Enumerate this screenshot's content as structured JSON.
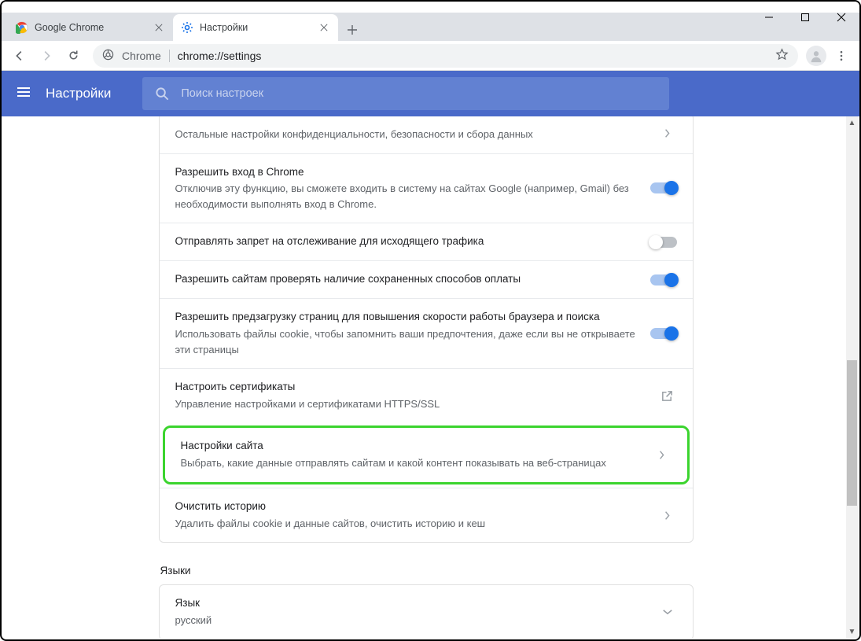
{
  "window": {
    "tabs": [
      {
        "title": "Google Chrome"
      },
      {
        "title": "Настройки"
      }
    ]
  },
  "omnibox": {
    "chrome_label": "Chrome",
    "url": "chrome://settings"
  },
  "header": {
    "title": "Настройки",
    "search_placeholder": "Поиск настроек"
  },
  "rows": {
    "sync": {
      "sub": "Остальные настройки конфиденциальности, безопасности и сбора данных"
    },
    "signin": {
      "title": "Разрешить вход в Chrome",
      "sub": "Отключив эту функцию, вы сможете входить в систему на сайтах Google (например, Gmail) без необходимости выполнять вход в Chrome."
    },
    "dnt": {
      "title": "Отправлять запрет на отслеживание для исходящего трафика"
    },
    "payment": {
      "title": "Разрешить сайтам проверять наличие сохраненных способов оплаты"
    },
    "preload": {
      "title": "Разрешить предзагрузку страниц для повышения скорости работы браузера и поиска",
      "sub": "Использовать файлы cookie, чтобы запомнить ваши предпочтения, даже если вы не открываете эти страницы"
    },
    "certs": {
      "title": "Настроить сертификаты",
      "sub": "Управление настройками и сертификатами HTTPS/SSL"
    },
    "site": {
      "title": "Настройки сайта",
      "sub": "Выбрать, какие данные отправлять сайтам и какой контент показывать на веб-страницах"
    },
    "clear": {
      "title": "Очистить историю",
      "sub": "Удалить файлы cookie и данные сайтов, очистить историю и кеш"
    }
  },
  "languages": {
    "section": "Языки",
    "lang_label": "Язык",
    "lang_value": "русский"
  }
}
